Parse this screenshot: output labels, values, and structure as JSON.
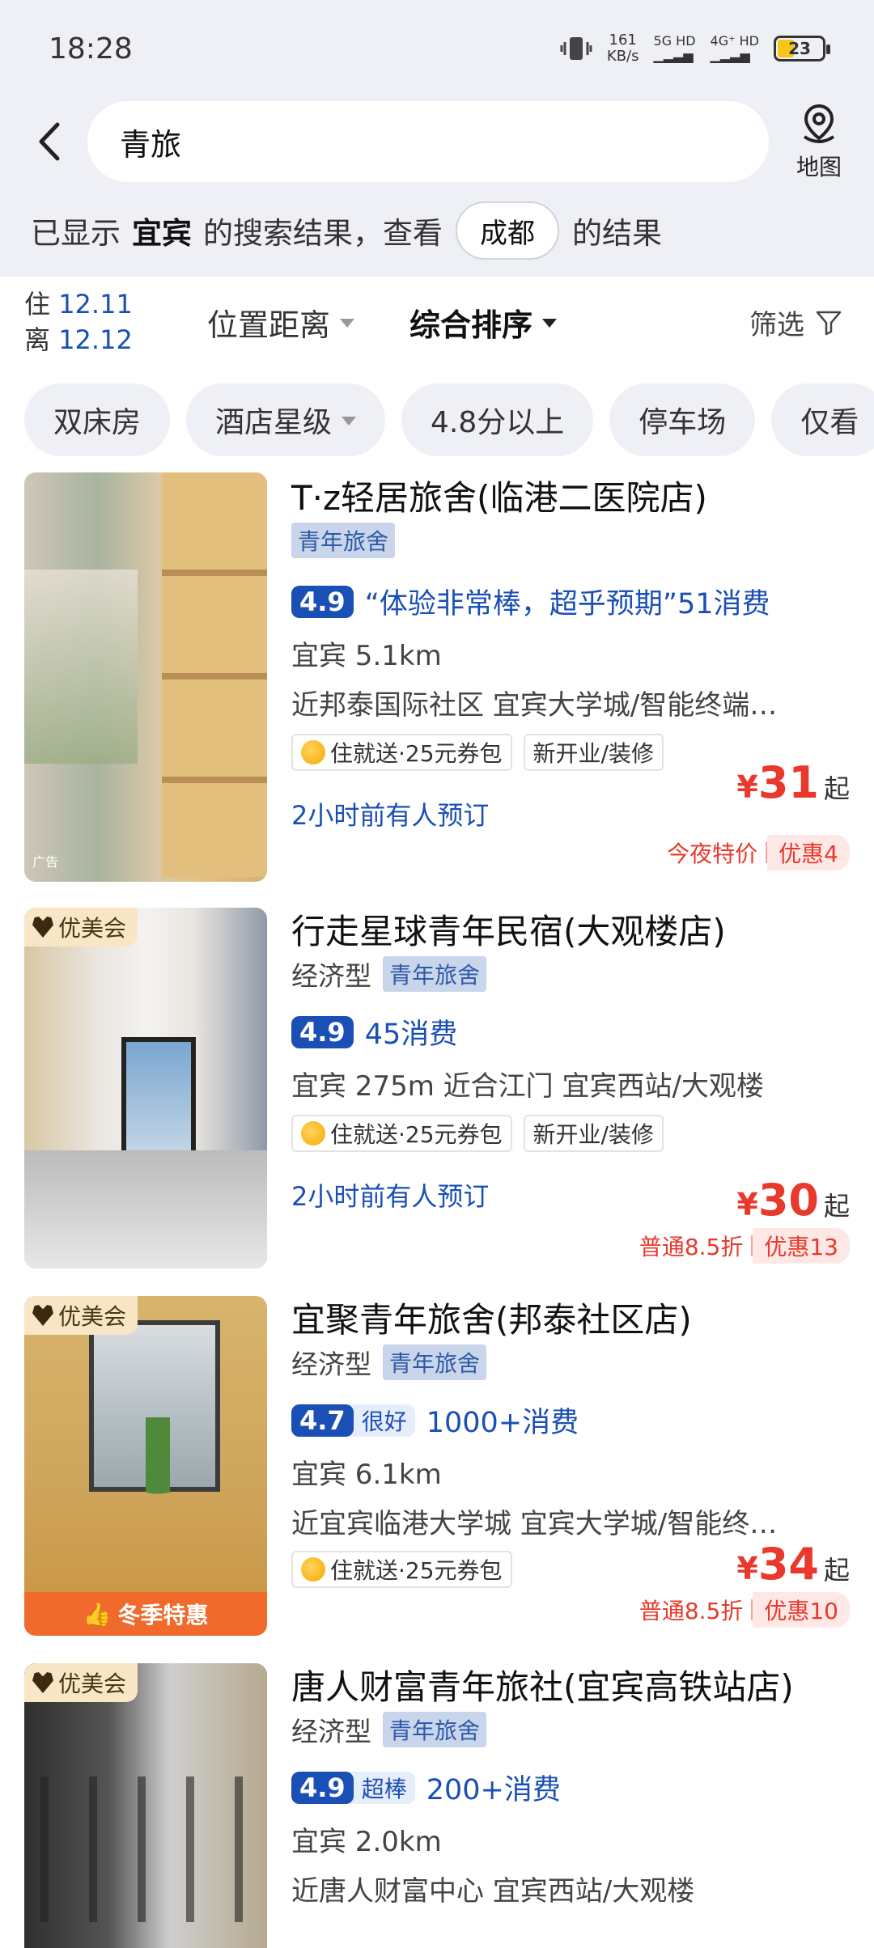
{
  "status": {
    "time": "18:28",
    "speed_value": "161",
    "speed_unit": "KB/s",
    "net1": "5G HD",
    "net2": "4G⁺ HD",
    "battery": "23"
  },
  "search": {
    "query": "青旅",
    "map_label": "地图"
  },
  "notice": {
    "prefix": "已显示",
    "city": "宜宾",
    "middle": "的搜索结果，查看",
    "alt_city": "成都",
    "suffix": "的结果"
  },
  "filters": {
    "checkin_label": "住",
    "checkin": "12.11",
    "checkout_label": "离",
    "checkout": "12.12",
    "position": "位置距离",
    "sort": "综合排序",
    "screen": "筛选"
  },
  "chips": [
    "双床房",
    "酒店星级",
    "4.8分以上",
    "停车场",
    "仅看"
  ],
  "hotels": [
    {
      "name": "T·z轻居旅舍(临港二医院店)",
      "category": "",
      "tag": "青年旅舍",
      "score": "4.9",
      "score_label": "",
      "review": "“体验非常棒，超乎预期”51消费",
      "distance": "宜宾 5.1km",
      "location": "近邦泰国际社区    宜宾大学城/智能终端…",
      "promo1": "住就送·25元券包",
      "promo2": "新开业/装修",
      "booked": "2小时前有人预订",
      "price_symbol": "¥",
      "price": "31",
      "price_suffix": "起",
      "deal_a": "今夜特价",
      "deal_b": "优惠4",
      "ad": "广告"
    },
    {
      "vip": "优美会",
      "name": "行走星球青年民宿(大观楼店)",
      "category": "经济型",
      "tag": "青年旅舍",
      "score": "4.9",
      "score_label": "",
      "review": "45消费",
      "location": "宜宾 275m    近合江门    宜宾西站/大观楼",
      "promo1": "住就送·25元券包",
      "promo2": "新开业/装修",
      "booked": "2小时前有人预订",
      "price_symbol": "¥",
      "price": "30",
      "price_suffix": "起",
      "deal_a": "普通8.5折",
      "deal_b": "优惠13"
    },
    {
      "vip": "优美会",
      "name": "宜聚青年旅舍(邦泰社区店)",
      "category": "经济型",
      "tag": "青年旅舍",
      "score": "4.7",
      "score_label": "很好",
      "review": "1000+消费",
      "distance": "宜宾 6.1km",
      "location": "近宜宾临港大学城    宜宾大学城/智能终…",
      "promo1": "住就送·25元券包",
      "price_symbol": "¥",
      "price": "34",
      "price_suffix": "起",
      "deal_a": "普通8.5折",
      "deal_b": "优惠10",
      "winter": "冬季特惠"
    },
    {
      "vip": "优美会",
      "name": "唐人财富青年旅社(宜宾高铁站店)",
      "category": "经济型",
      "tag": "青年旅舍",
      "score": "4.9",
      "score_label": "超棒",
      "review": "200+消费",
      "distance": "宜宾 2.0km",
      "location": "近唐人财富中心    宜宾西站/大观楼"
    }
  ]
}
